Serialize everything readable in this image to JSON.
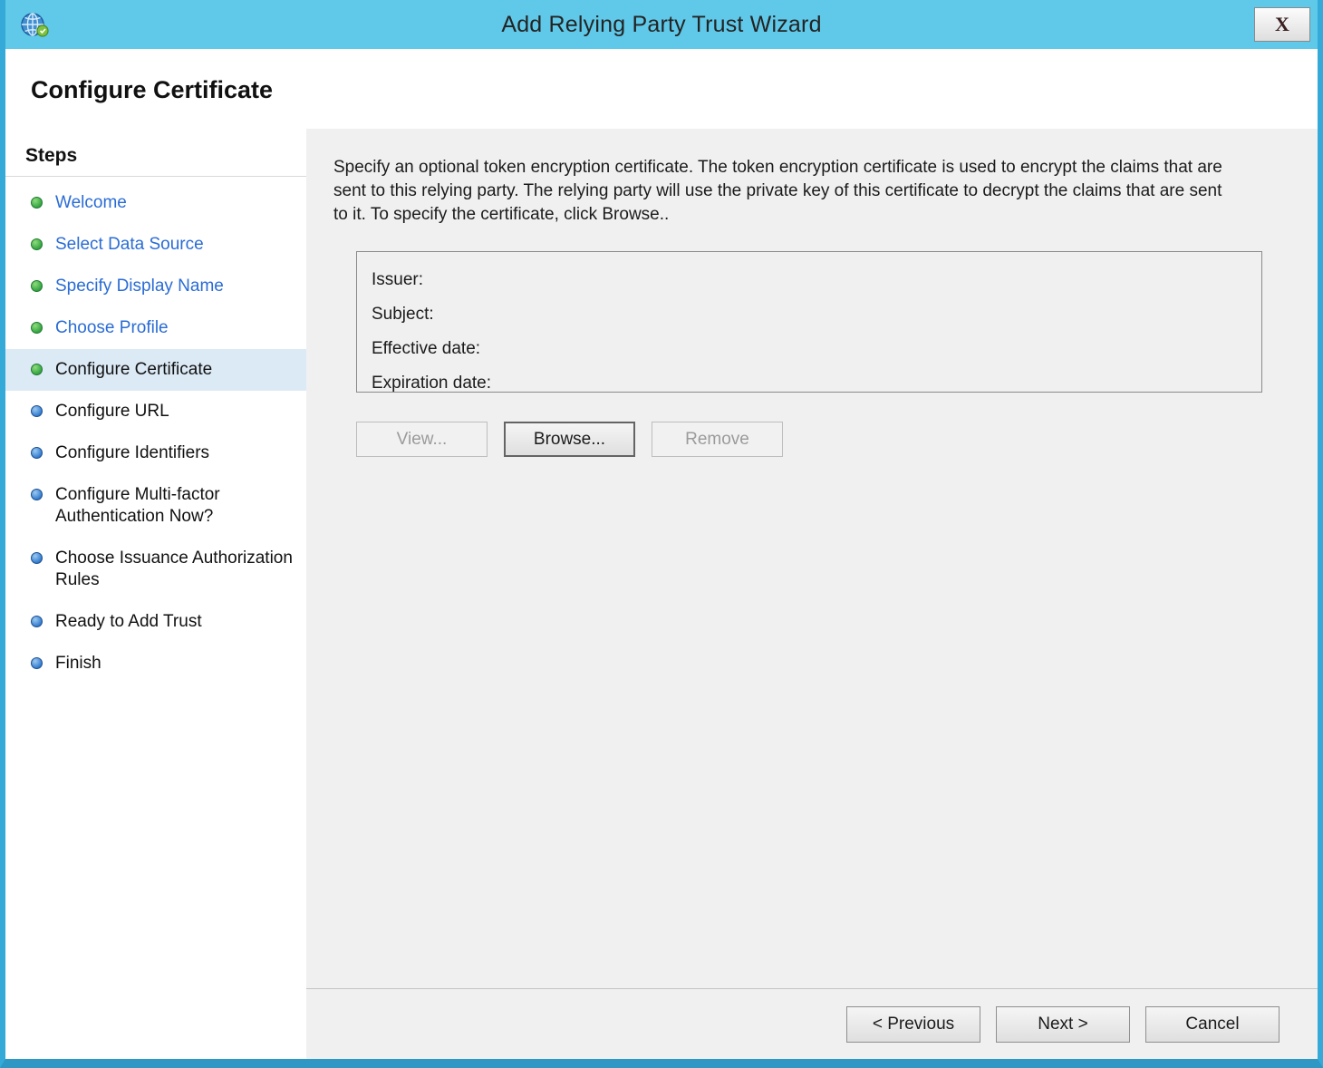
{
  "window": {
    "title": "Add Relying Party Trust Wizard",
    "close_label": "X",
    "page_title": "Configure Certificate"
  },
  "steps": {
    "header": "Steps",
    "items": [
      {
        "label": "Welcome",
        "state": "done"
      },
      {
        "label": "Select Data Source",
        "state": "done"
      },
      {
        "label": "Specify Display Name",
        "state": "done"
      },
      {
        "label": "Choose Profile",
        "state": "done"
      },
      {
        "label": "Configure Certificate",
        "state": "current"
      },
      {
        "label": "Configure URL",
        "state": "pending"
      },
      {
        "label": "Configure Identifiers",
        "state": "pending"
      },
      {
        "label": "Configure Multi-factor Authentication Now?",
        "state": "pending"
      },
      {
        "label": "Choose Issuance Authorization Rules",
        "state": "pending"
      },
      {
        "label": "Ready to Add Trust",
        "state": "pending"
      },
      {
        "label": "Finish",
        "state": "pending"
      }
    ]
  },
  "content": {
    "description": "Specify an optional token encryption certificate.  The token encryption certificate is used to encrypt the claims that are sent to this relying party.  The relying party will use the private key of this certificate to decrypt the claims that are sent to it.  To specify the certificate, click Browse..",
    "fields": [
      {
        "label": "Issuer:"
      },
      {
        "label": "Subject:"
      },
      {
        "label": "Effective date:"
      },
      {
        "label": "Expiration date:"
      }
    ],
    "buttons": {
      "view": "View...",
      "browse": "Browse...",
      "remove": "Remove"
    }
  },
  "footer": {
    "previous": "< Previous",
    "next": "Next >",
    "cancel": "Cancel"
  },
  "colors": {
    "titlebar": "#60c9e9",
    "window_border": "#35a9d7",
    "link_blue": "#2a6cd5",
    "done_bullet_green": "#3aa946",
    "pending_bullet_blue": "#3b82d2",
    "selected_step_bg": "#dceaf6",
    "content_bg": "#f0f0f0"
  }
}
